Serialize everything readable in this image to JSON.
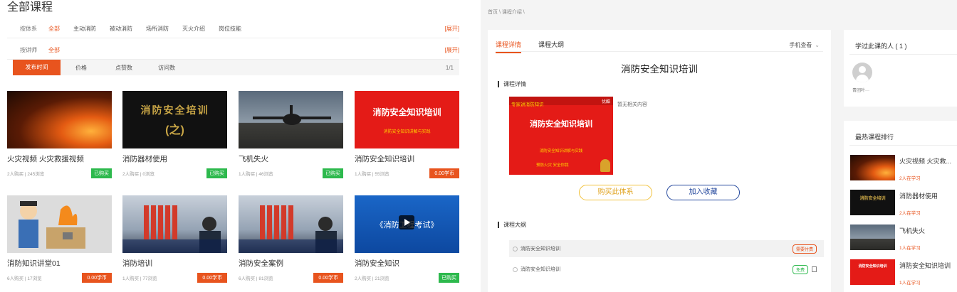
{
  "left": {
    "title": "全部课程",
    "filter1": {
      "label": "按体系",
      "options": [
        "全部",
        "主动消防",
        "被动消防",
        "场所消防",
        "灭火介绍",
        "岗位技能"
      ],
      "expand": "[展开]"
    },
    "filter2": {
      "label": "按讲师",
      "options": [
        "全部"
      ],
      "expand": "[展开]"
    },
    "sort": {
      "options": [
        "发布时间",
        "价格",
        "点赞数",
        "访问数"
      ],
      "pager": "1/1"
    },
    "courses": [
      {
        "title": "火灾视频 火灾救援视频",
        "meta": "2人购买 | 245浏览",
        "badge": "已购买",
        "badge_type": "green",
        "thumb": "fire-icon"
      },
      {
        "title": "消防器材使用",
        "meta": "2人购买 | 0浏览",
        "badge": "已购买",
        "badge_type": "green",
        "thumb": "black",
        "thumb_text": [
          "消防安全培训",
          "(之)"
        ]
      },
      {
        "title": "飞机失火",
        "meta": "1人购买 | 46浏览",
        "badge": "已购买",
        "badge_type": "green",
        "thumb": "plane"
      },
      {
        "title": "消防安全知识培训",
        "meta": "1人购买 | 55浏览",
        "badge": "0.00学币",
        "badge_type": "orange",
        "thumb": "red",
        "thumb_text": [
          "消防安全知识培训",
          "消防安全知识讲解与实践"
        ]
      },
      {
        "title": "消防知识讲堂01",
        "meta": "6人购买 | 17浏览",
        "badge": "0.00学币",
        "badge_type": "orange",
        "thumb": "cartoon"
      },
      {
        "title": "消防培训",
        "meta": "1人购买 | 77浏览",
        "badge": "0.00学币",
        "badge_type": "orange",
        "thumb": "lab"
      },
      {
        "title": "消防安全案例",
        "meta": "6人购买 | 81浏览",
        "badge": "0.00学币",
        "badge_type": "orange",
        "thumb": "lab"
      },
      {
        "title": "消防安全知识",
        "meta": "2人购买 | 21浏览",
        "badge": "已购买",
        "badge_type": "green",
        "thumb": "blue",
        "thumb_text": [
          "《消防工程考试》"
        ]
      }
    ]
  },
  "right": {
    "breadcrumb": "首页 \\ 课程介绍 \\",
    "tabs": [
      "课程详情",
      "课程大纲"
    ],
    "mobile_view": "手机查看",
    "course_title": "消防安全知识培训",
    "detail_heading": "课程详情",
    "cover": {
      "strip": "专家讲消防知识",
      "corner": "优酷",
      "title": "消防安全知识培训",
      "sub": "消防安全知识讲解与实践",
      "bottom": "预防火灾 安全你我"
    },
    "no_content": "暂无相关内容",
    "buy_system": "购买此体系",
    "add_favorite": "加入收藏",
    "outline_heading": "课程大纲",
    "lessons": [
      {
        "name": "消防安全知识培训",
        "tag": "需要付费"
      },
      {
        "name": "消防安全知识培训",
        "tag": "免费"
      }
    ],
    "learners_heading": "学过此课的人 ( 1 )",
    "learner_name": "青团叶···",
    "ranking_heading": "最热课程排行",
    "ranking": [
      {
        "title": "火灾视频 火灾救...",
        "stat": "2人在学习"
      },
      {
        "title": "消防器材使用",
        "stat": "2人在学习",
        "thumb_text": "消防安全培训"
      },
      {
        "title": "飞机失火",
        "stat": "1人在学习"
      },
      {
        "title": "消防安全知识培训",
        "stat": "1人在学习",
        "thumb_text": "消防安全知识培训"
      }
    ]
  }
}
